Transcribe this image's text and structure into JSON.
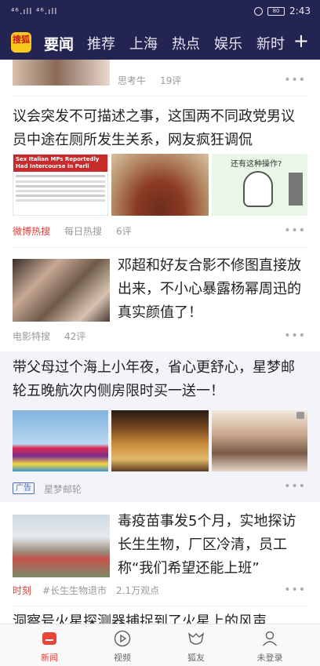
{
  "status_bar": {
    "signal": "⁴⁶.ıll ⁴⁶.ıll",
    "battery": "80",
    "time": "2:43"
  },
  "header": {
    "logo": "搜狐",
    "tabs": [
      "要闻",
      "推荐",
      "上海",
      "热点",
      "娱乐",
      "新时"
    ],
    "add": "+"
  },
  "feed": [
    {
      "source": "思考牛",
      "comments": "19评"
    },
    {
      "title": "议会突发不可描述之事，这国两不同政党男议员中途在厕所发生关系，网友疯狂调侃",
      "tag": "微博热搜",
      "source": "每日热搜",
      "comments": "6评",
      "img1_headline": "Sex Italian MPs Reportedly Had Intercourse in Parli",
      "img3_text": "还有这种操作?"
    },
    {
      "title": "邓超和好友合影不修图直接放出来，不小心暴露杨幂周迅的真实颜值了！",
      "source": "电影特搜",
      "comments": "42评"
    },
    {
      "title": "带父母过个海上小年夜，省心更舒心，星梦邮轮五晚航次内侧房限时买一送一！",
      "ad_label": "广告",
      "source": "星梦邮轮"
    },
    {
      "title": "毒疫苗事发5个月，实地探访长生生物，厂区冷清，员工称“我们希望还能上班”",
      "tag": "时刻",
      "topic": "#长生生物退市",
      "views": "2.1万观点"
    },
    {
      "title": "洞察号火星探测器捕捉到了火星上的风声"
    }
  ],
  "bottom_nav": [
    "新闻",
    "视频",
    "狐友",
    "未登录"
  ],
  "colors": {
    "header": "#242452",
    "accent": "#e8463a",
    "ad_bg": "#f2f4f9"
  }
}
